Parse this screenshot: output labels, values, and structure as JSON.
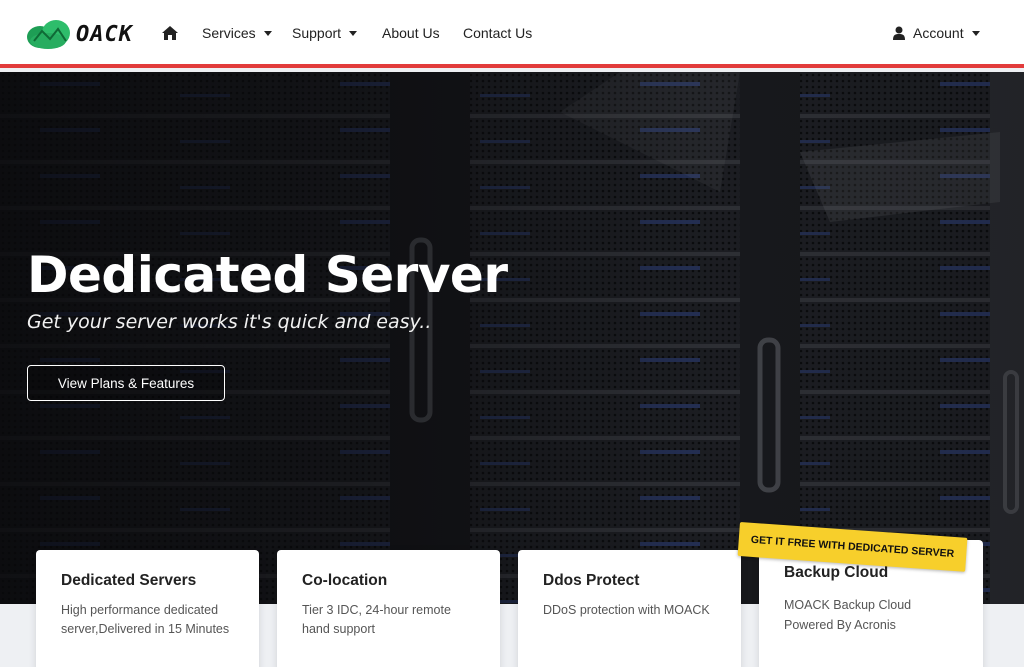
{
  "brand": {
    "logo_text": "OACK",
    "accent": "#2ebd6b",
    "border_accent": "#e23b3b"
  },
  "nav": {
    "home_icon": "home-icon",
    "items": [
      {
        "label": "Services",
        "dropdown": true
      },
      {
        "label": "Support",
        "dropdown": true
      },
      {
        "label": "About Us",
        "dropdown": false
      },
      {
        "label": "Contact Us",
        "dropdown": false
      }
    ],
    "account": {
      "label": "Account",
      "icon": "user-icon"
    }
  },
  "hero": {
    "title": "Dedicated Server",
    "subtitle": "Get your server works it's quick and easy..",
    "button": "View Plans & Features"
  },
  "cards": [
    {
      "title": "Dedicated Servers",
      "text_lines": [
        "High performance dedicated",
        "server,Delivered in 15 Minutes"
      ]
    },
    {
      "title": "Co-location",
      "text_lines": [
        "Tier 3 IDC, 24-hour remote",
        "hand support"
      ]
    },
    {
      "title": "Ddos Protect",
      "text_lines": [
        "DDoS protection with MOACK"
      ]
    },
    {
      "title": "Backup Cloud",
      "text_lines": [
        "MOACK Backup Cloud",
        "Powered By Acronis"
      ],
      "ribbon": "GET IT FREE WITH DEDICATED SERVER"
    }
  ]
}
